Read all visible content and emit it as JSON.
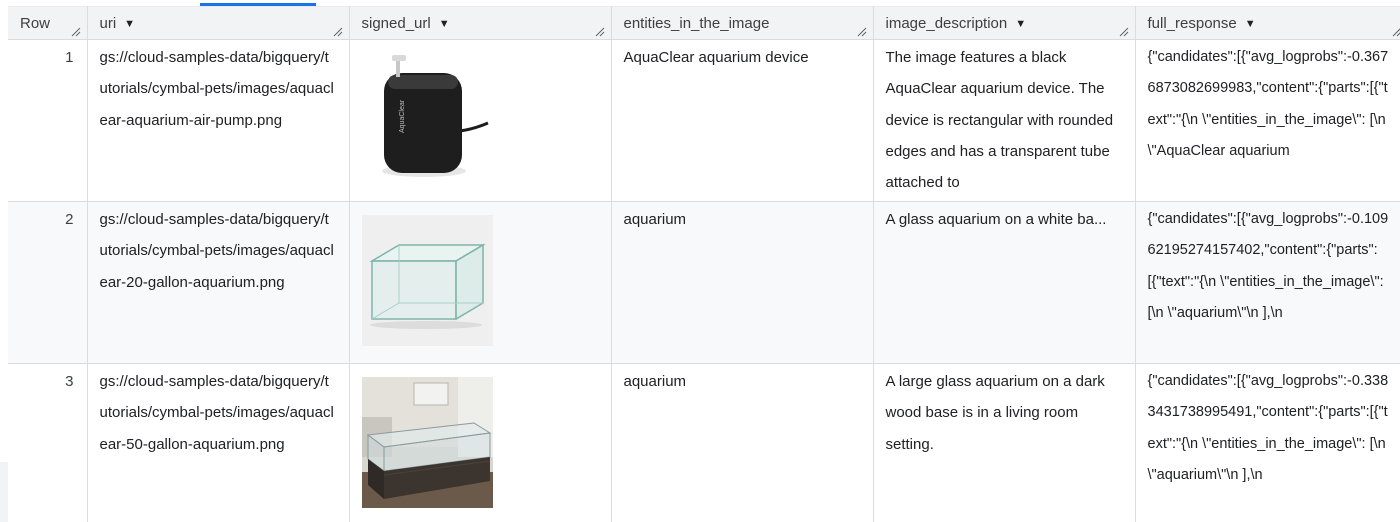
{
  "columns": [
    {
      "label": "Row",
      "has_menu": false
    },
    {
      "label": "uri",
      "has_menu": true
    },
    {
      "label": "signed_url",
      "has_menu": true
    },
    {
      "label": "entities_in_the_image",
      "has_menu": false
    },
    {
      "label": "image_description",
      "has_menu": true
    },
    {
      "label": "full_response",
      "has_menu": true
    }
  ],
  "rows": [
    {
      "row": "1",
      "uri": "gs://cloud-samples-data/bigquery/tutorials/cymbal-pets/images/aquaclear-aquarium-air-pump.png",
      "image": "black-air-pump-photo",
      "device_brand": "AquaClear",
      "entities": "AquaClear aquarium device",
      "description": "The image features a black AquaClear aquarium device. The device is rectangular with rounded edges and has a transparent tube attached to",
      "full_response": "{\"candidates\":[{\"avg_logprobs\":-0.3676873082699983,\"content\":{\"parts\":[{\"text\":\"{\\n \\\"entities_in_the_image\\\": [\\n \\\"AquaClear aquarium"
    },
    {
      "row": "2",
      "uri": "gs://cloud-samples-data/bigquery/tutorials/cymbal-pets/images/aquaclear-20-gallon-aquarium.png",
      "image": "glass-tank-photo",
      "entities": "aquarium",
      "description": "A glass aquarium on a white ba...",
      "full_response": "{\"candidates\":[{\"avg_logprobs\":-0.10962195274157402,\"content\":{\"parts\":[{\"text\":\"{\\n \\\"entities_in_the_image\\\": [\\n \\\"aquarium\\\"\\n ],\\n"
    },
    {
      "row": "3",
      "uri": "gs://cloud-samples-data/bigquery/tutorials/cymbal-pets/images/aquaclear-50-gallon-aquarium.png",
      "image": "living-room-aquarium-photo",
      "entities": "aquarium",
      "description": "A large glass aquarium on a dark wood base is in a living room setting.",
      "full_response": "{\"candidates\":[{\"avg_logprobs\":-0.3383431738995491,\"content\":{\"parts\":[{\"text\":\"{\\n \\\"entities_in_the_image\\\": [\\n \\\"aquarium\\\"\\n ],\\n"
    }
  ],
  "colors": {
    "header_bg": "#f1f3f4",
    "alt_row_bg": "#f8f9fa",
    "border": "#dadce0",
    "accent": "#1a73e8",
    "text": "#202124"
  }
}
